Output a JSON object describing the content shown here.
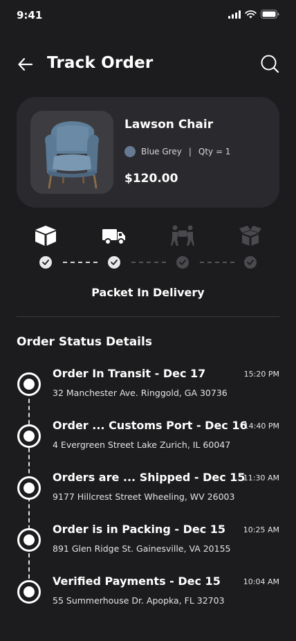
{
  "status_bar": {
    "time": "9:41"
  },
  "header": {
    "title": "Track Order"
  },
  "product": {
    "name": "Lawson Chair",
    "color_name": "Blue Grey",
    "color_hex": "#667a93",
    "separator": "|",
    "quantity": "Qty = 1",
    "price": "$120.00"
  },
  "tracker": {
    "steps": [
      {
        "icon": "package-icon",
        "done": true
      },
      {
        "icon": "delivery-truck-icon",
        "done": true
      },
      {
        "icon": "courier-handover-icon",
        "done": false
      },
      {
        "icon": "open-box-icon",
        "done": false
      }
    ],
    "current_status": "Packet In Delivery"
  },
  "order_status": {
    "title": "Order Status Details",
    "items": [
      {
        "title": "Order In Transit - Dec 17",
        "address": "32 Manchester Ave. Ringgold, GA 30736",
        "time": "15:20 PM"
      },
      {
        "title": "Order ... Customs Port - Dec 16",
        "address": "4 Evergreen Street Lake Zurich, IL 60047",
        "time": "14:40 PM"
      },
      {
        "title": "Orders are ... Shipped - Dec 15",
        "address": "9177 Hillcrest Street Wheeling, WV 26003",
        "time": "11:30 AM"
      },
      {
        "title": "Order is in Packing - Dec 15",
        "address": "891 Glen Ridge St. Gainesville, VA 20155",
        "time": "10:25 AM"
      },
      {
        "title": "Verified Payments - Dec 15",
        "address": "55 Summerhouse Dr. Apopka, FL 32703",
        "time": "10:04 AM"
      }
    ]
  },
  "colors": {
    "background": "#1c1c1e",
    "card": "#2a2a2e",
    "text": "#ffffff",
    "inactive": "#4a4a4e"
  }
}
